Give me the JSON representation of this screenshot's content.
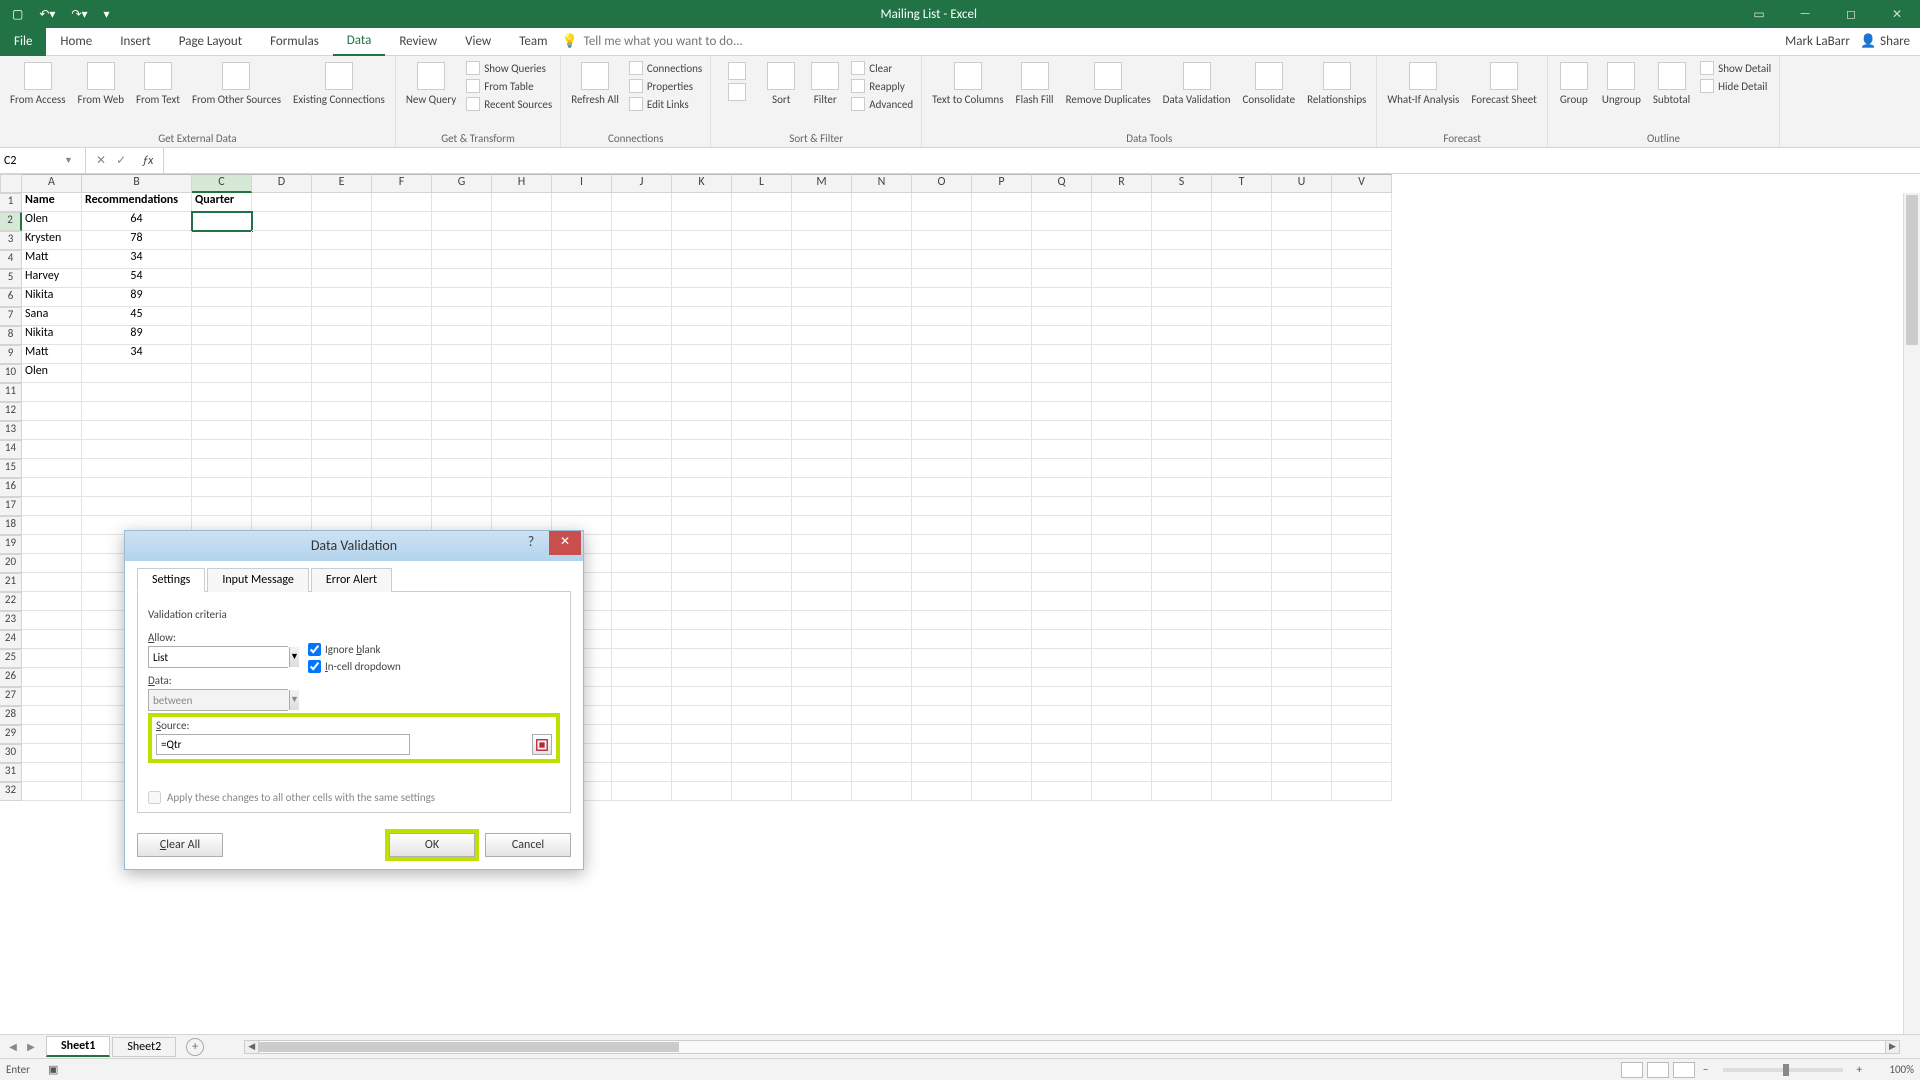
{
  "titlebar": {
    "title": "Mailing List - Excel"
  },
  "ribbon": {
    "tabs": [
      "File",
      "Home",
      "Insert",
      "Page Layout",
      "Formulas",
      "Data",
      "Review",
      "View",
      "Team"
    ],
    "active": "Data",
    "tellme": "Tell me what you want to do...",
    "user": "Mark LaBarr",
    "share": "Share",
    "groups": {
      "getExternal": {
        "title": "Get External Data",
        "items": [
          "From Access",
          "From Web",
          "From Text",
          "From Other Sources",
          "Existing Connections"
        ]
      },
      "getTransform": {
        "title": "Get & Transform",
        "newQuery": "New Query",
        "list": [
          "Show Queries",
          "From Table",
          "Recent Sources"
        ]
      },
      "connections": {
        "title": "Connections",
        "refresh": "Refresh All",
        "list": [
          "Connections",
          "Properties",
          "Edit Links"
        ]
      },
      "sortFilter": {
        "title": "Sort & Filter",
        "sort": "Sort",
        "filter": "Filter",
        "list": [
          "Clear",
          "Reapply",
          "Advanced"
        ]
      },
      "dataTools": {
        "title": "Data Tools",
        "items": [
          "Text to Columns",
          "Flash Fill",
          "Remove Duplicates",
          "Data Validation",
          "Consolidate",
          "Relationships"
        ]
      },
      "forecast": {
        "title": "Forecast",
        "items": [
          "What-If Analysis",
          "Forecast Sheet"
        ]
      },
      "outline": {
        "title": "Outline",
        "items": [
          "Group",
          "Ungroup",
          "Subtotal"
        ],
        "list": [
          "Show Detail",
          "Hide Detail"
        ]
      }
    }
  },
  "namebox": "C2",
  "columns": [
    "A",
    "B",
    "C",
    "D",
    "E",
    "F",
    "G",
    "H",
    "I",
    "J",
    "K",
    "L",
    "M",
    "N",
    "O",
    "P",
    "Q",
    "R",
    "S",
    "T",
    "U",
    "V"
  ],
  "rows": {
    "headers": {
      "A": "Name",
      "B": "Recommendations",
      "C": "Quarter"
    },
    "data": [
      {
        "A": "Olen",
        "B": "64"
      },
      {
        "A": "Krysten",
        "B": "78"
      },
      {
        "A": "Matt",
        "B": "34"
      },
      {
        "A": "Harvey",
        "B": "54"
      },
      {
        "A": "Nikita",
        "B": "89"
      },
      {
        "A": "Sana",
        "B": "45"
      },
      {
        "A": "Nikita",
        "B": "89"
      },
      {
        "A": "Matt",
        "B": "34"
      },
      {
        "A": "Olen",
        "B": ""
      }
    ]
  },
  "activeCell": "C2",
  "sheets": {
    "tabs": [
      "Sheet1",
      "Sheet2"
    ],
    "active": "Sheet1"
  },
  "status": {
    "mode": "Enter",
    "zoom": "100%"
  },
  "dialog": {
    "title": "Data Validation",
    "tabs": [
      "Settings",
      "Input Message",
      "Error Alert"
    ],
    "activeTab": "Settings",
    "criteria": "Validation criteria",
    "allowLabel": "Allow:",
    "allowValue": "List",
    "dataLabel": "Data:",
    "dataValue": "between",
    "ignoreBlank": "Ignore blank",
    "inCellDropdown": "In-cell dropdown",
    "sourceLabel": "Source:",
    "sourceValue": "=Qtr",
    "applyAll": "Apply these changes to all other cells with the same settings",
    "clearAll": "Clear All",
    "ok": "OK",
    "cancel": "Cancel"
  }
}
